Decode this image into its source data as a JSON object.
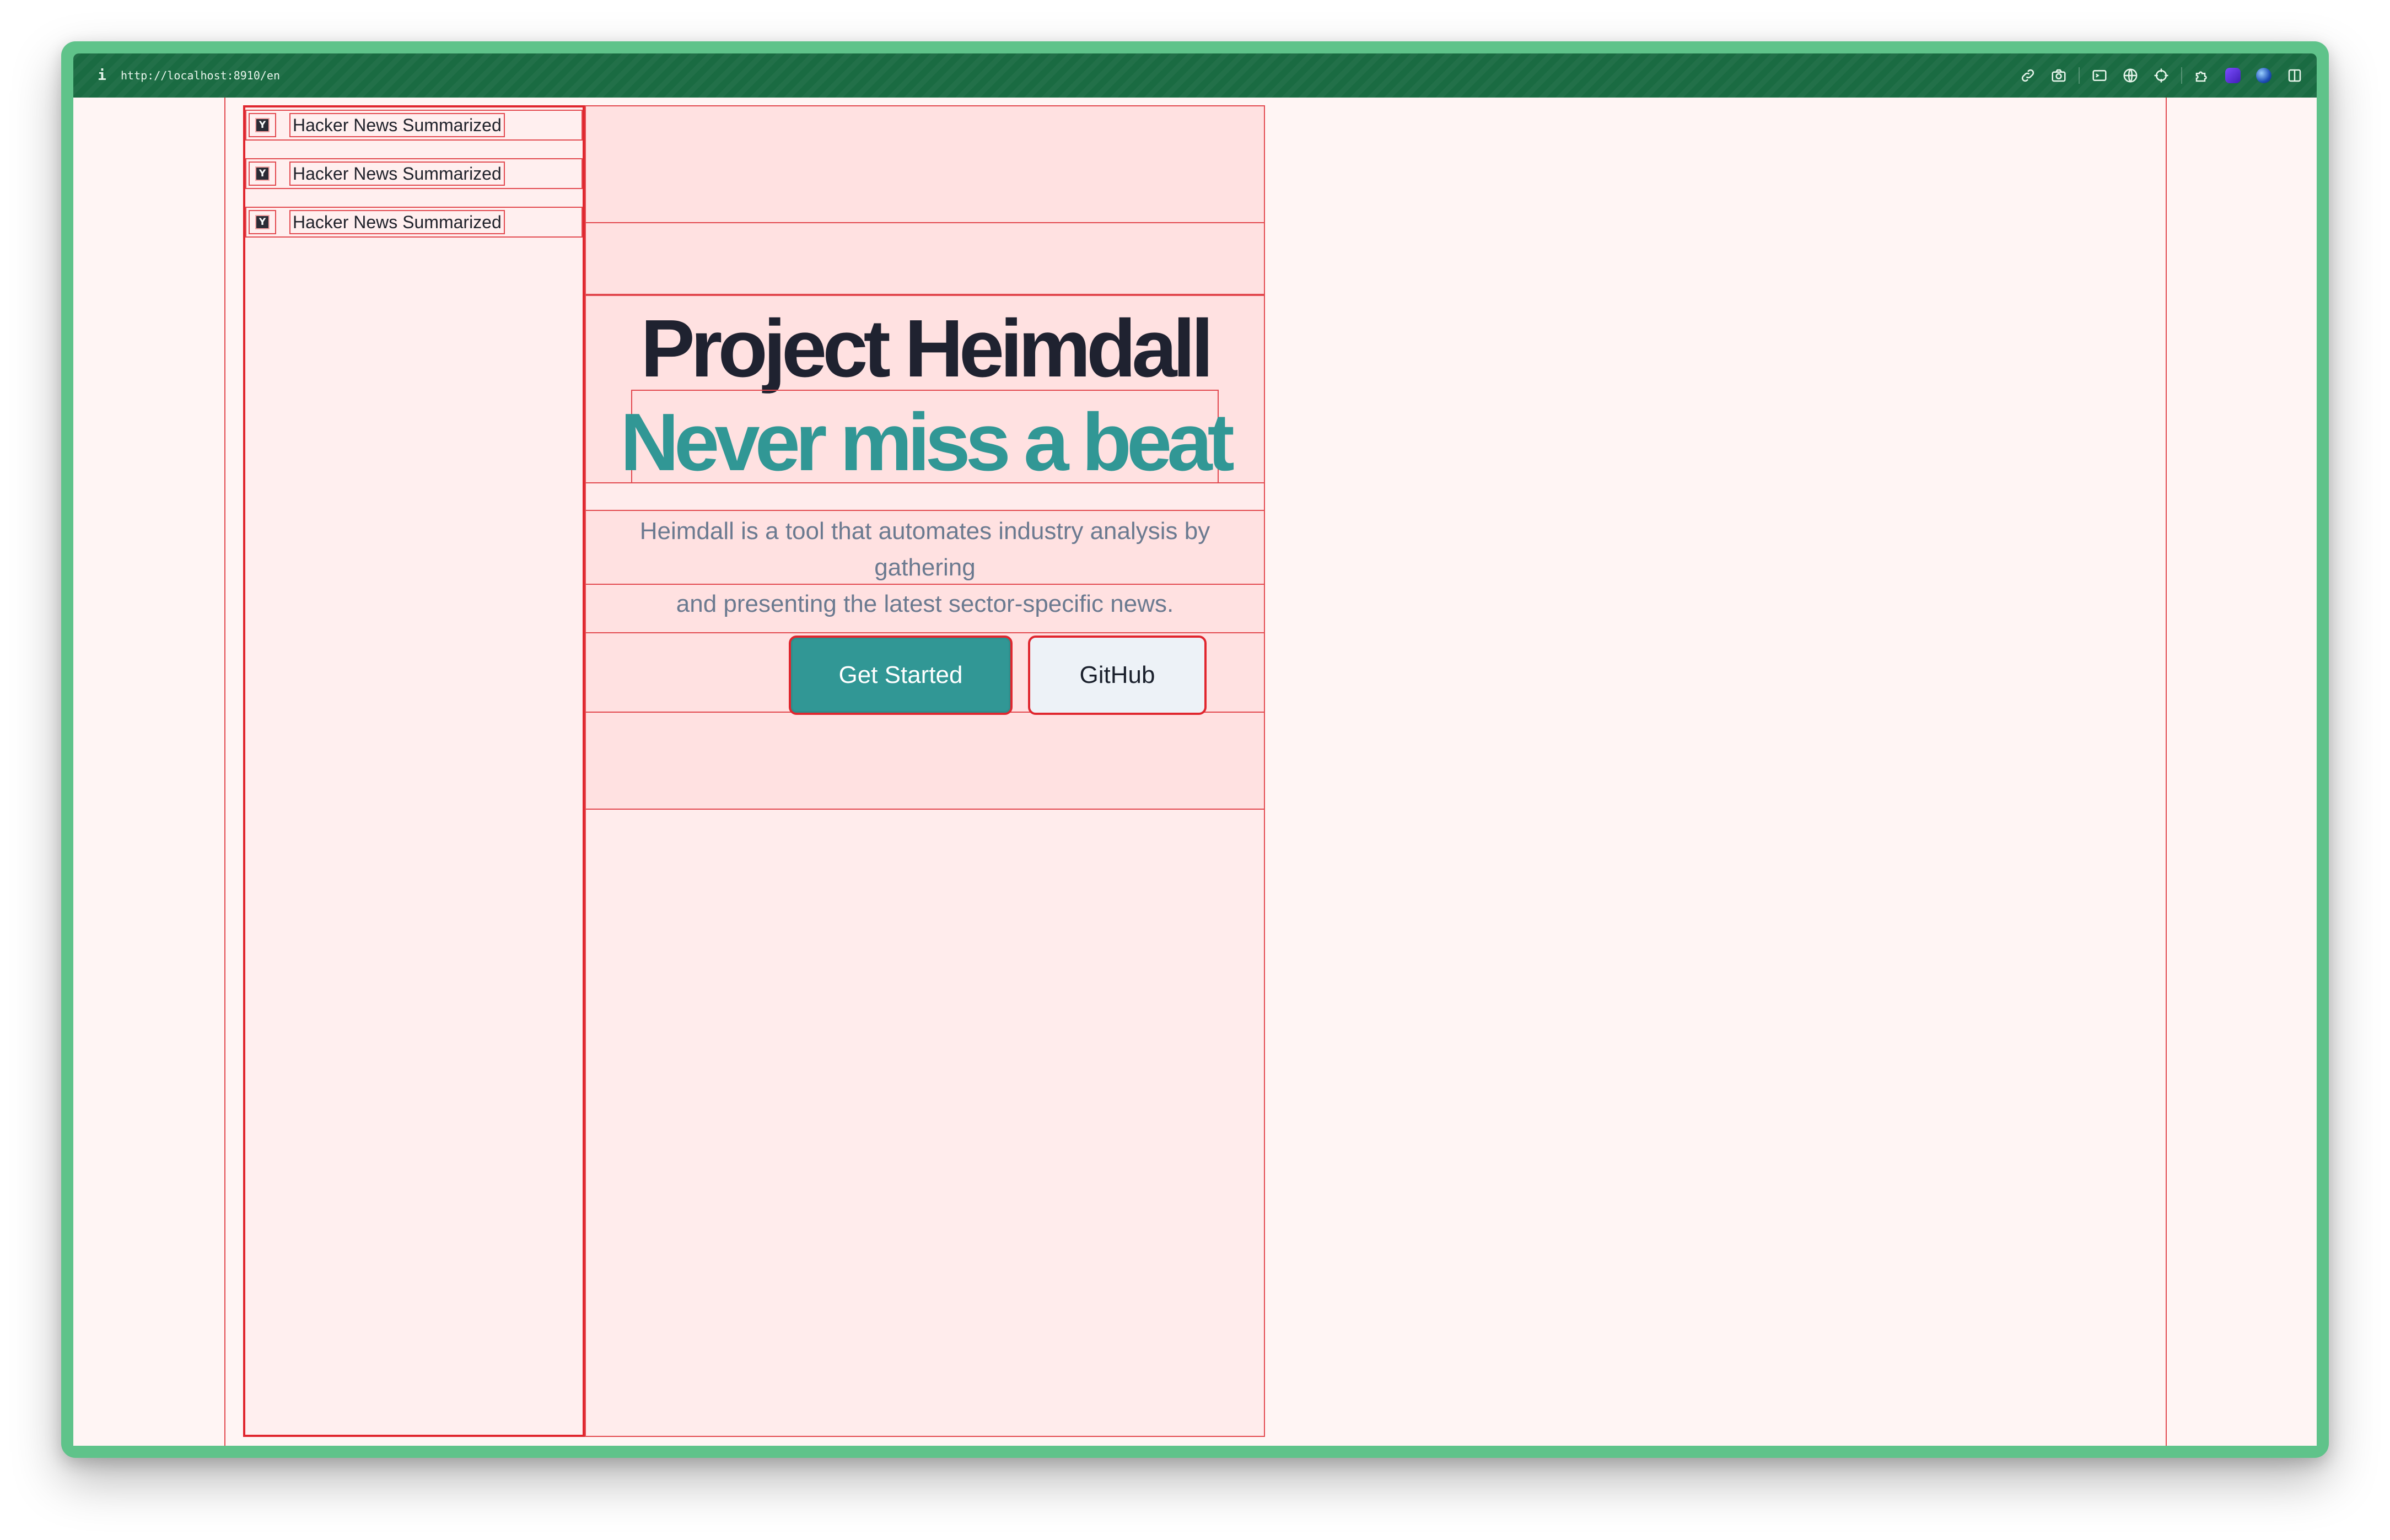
{
  "browser": {
    "info_glyph": "i",
    "url": "http://localhost:8910/en"
  },
  "toolbar": {
    "icons": [
      "link-icon",
      "camera-icon",
      "terminal-icon",
      "globe-icon",
      "crosshair-icon",
      "puzzle-icon",
      "extension-purple-icon",
      "extension-blue-icon",
      "sidebar-toggle-icon"
    ]
  },
  "sidebar": {
    "items": [
      {
        "icon": "Y",
        "label": "Hacker News Summarized"
      },
      {
        "icon": "Y",
        "label": "Hacker News Summarized"
      },
      {
        "icon": "Y",
        "label": "Hacker News Summarized"
      }
    ]
  },
  "hero": {
    "title": "Project Heimdall",
    "subtitle": "Never miss a beat",
    "description_line1": "Heimdall is a tool that automates industry analysis by gathering",
    "description_line2": "and presenting the latest sector-specific news."
  },
  "buttons": {
    "primary": "Get Started",
    "secondary": "GitHub"
  },
  "colors": {
    "accent": "#319795",
    "title": "#1f2230",
    "debug_outline": "#e8323a",
    "window_frame": "#5fc38a",
    "toolbar": "#1a6b42"
  }
}
